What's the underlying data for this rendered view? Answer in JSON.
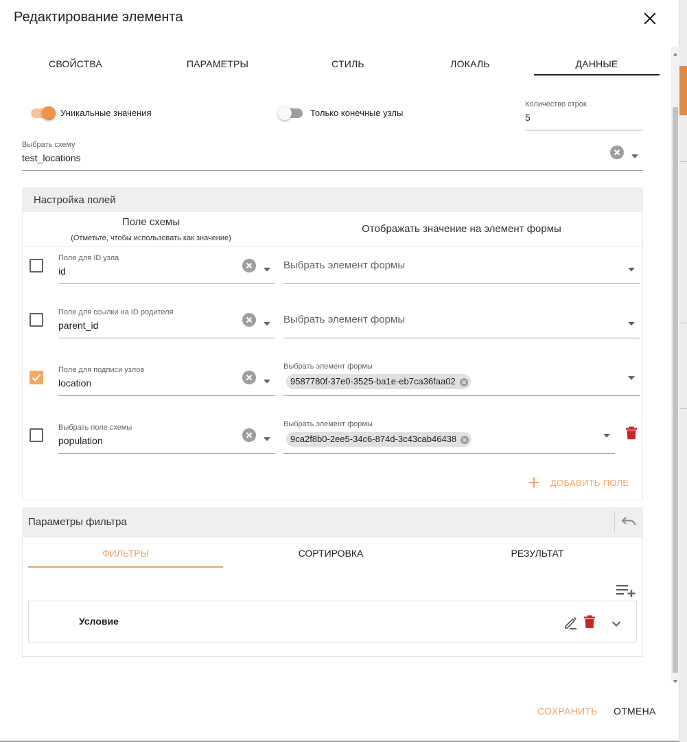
{
  "dialog": {
    "title": "Редактирование элемента"
  },
  "tabs": [
    {
      "label": "СВОЙСТВА"
    },
    {
      "label": "ПАРАМЕТРЫ"
    },
    {
      "label": "СТИЛЬ"
    },
    {
      "label": "ЛОКАЛЬ"
    },
    {
      "label": "ДАННЫЕ",
      "active": true
    }
  ],
  "options": {
    "unique_values": {
      "label": "Уникальные значения",
      "on": true
    },
    "leaf_nodes_only": {
      "label": "Только конечные узлы",
      "on": false
    },
    "row_count": {
      "label": "Количество строк",
      "value": "5"
    }
  },
  "schema": {
    "label": "Выбрать схему",
    "value": "test_locations"
  },
  "field_settings": {
    "title": "Настройка полей",
    "col_schema_field": "Поле схемы",
    "col_schema_field_hint": "(Отметьте, чтобы использовать как значение)",
    "col_display": "Отображать значение на элемент формы",
    "rows": [
      {
        "checked": false,
        "field_label": "Поле для ID узла",
        "field_value": "id",
        "element_label": "",
        "element_placeholder": "Выбрать элемент формы",
        "chip": ""
      },
      {
        "checked": false,
        "field_label": "Поле для ссылки на ID родителя",
        "field_value": "parent_id",
        "element_label": "",
        "element_placeholder": "Выбрать элемент формы",
        "chip": ""
      },
      {
        "checked": true,
        "field_label": "Поле для подписи узлов",
        "field_value": "location",
        "element_label": "Выбрать элемент формы",
        "element_placeholder": "",
        "chip": "9587780f-37e0-3525-ba1e-eb7ca36faa02"
      },
      {
        "checked": false,
        "field_label": "Выбрать поле схемы",
        "field_value": "population",
        "element_label": "Выбрать элемент формы",
        "element_placeholder": "",
        "chip": "9ca2f8b0-2ee5-34c6-874d-3c43cab46438"
      }
    ],
    "add_field_label": "ДОБАВИТЬ ПОЛЕ"
  },
  "filter": {
    "title": "Параметры фильтра",
    "tabs": [
      {
        "label": "ФИЛЬТРЫ",
        "active": true
      },
      {
        "label": "СОРТИРОВКА"
      },
      {
        "label": "РЕЗУЛЬТАТ"
      }
    ],
    "condition_label": "Условие"
  },
  "footer": {
    "save_label": "СОХРАНИТЬ",
    "cancel_label": "ОТМЕНА"
  },
  "colors": {
    "accent": "#f4a261",
    "toggle_thumb_on": "#f0934a",
    "toggle_track_on": "#f6c49b",
    "delete_red": "#c62828",
    "panel_bg": "#eeeeee"
  },
  "icons": {
    "close": "close-icon",
    "clear": "clear-circle-icon",
    "dropdown": "chevron-down-icon",
    "delete": "trash-icon",
    "add": "plus-icon",
    "undo": "undo-icon",
    "add_list": "playlist-add-icon",
    "edit": "edit-pencil-icon",
    "expand": "expand-more-icon"
  }
}
